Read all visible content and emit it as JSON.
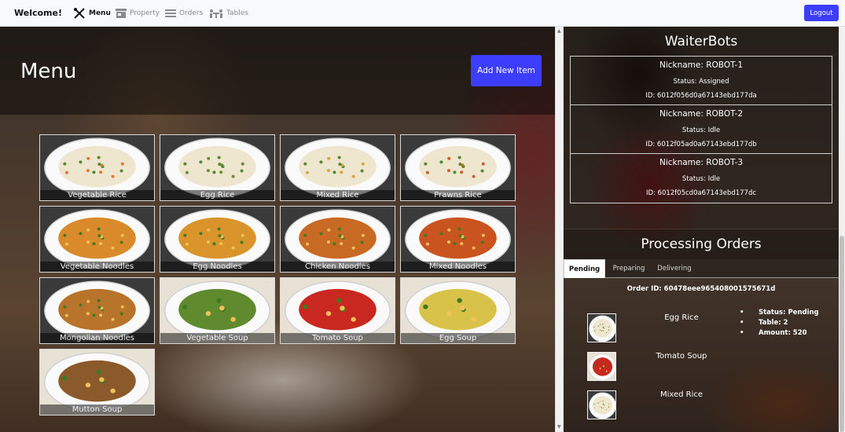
{
  "navbar": {
    "brand": "Welcome!",
    "links": [
      {
        "label": "Menu",
        "icon": "fork-knife-icon",
        "active": true
      },
      {
        "label": "Property",
        "icon": "store-icon",
        "active": false
      },
      {
        "label": "Orders",
        "icon": "list-icon",
        "active": false
      },
      {
        "label": "Tables",
        "icon": "table-icon",
        "active": false
      }
    ],
    "logout_label": "Logout"
  },
  "menu": {
    "title": "Menu",
    "add_button_label": "Add New Item",
    "items": [
      {
        "name": "Vegetable Rice",
        "kind": "rice",
        "accent": "#e07a2f"
      },
      {
        "name": "Egg Rice",
        "kind": "rice",
        "accent": "#6d8a3a"
      },
      {
        "name": "Mixed Rice",
        "kind": "rice",
        "accent": "#d9a441"
      },
      {
        "name": "Prawns Rice",
        "kind": "rice",
        "accent": "#c8622b"
      },
      {
        "name": "Vegetable Noodles",
        "kind": "noodles",
        "accent": "#d98a2b"
      },
      {
        "name": "Egg Noodles",
        "kind": "noodles",
        "accent": "#d9952b"
      },
      {
        "name": "Chicken Noodles",
        "kind": "noodles",
        "accent": "#c86a24"
      },
      {
        "name": "Mixed Noodles",
        "kind": "noodles",
        "accent": "#c9541f"
      },
      {
        "name": "Mongolian Noodles",
        "kind": "noodles",
        "accent": "#b8742b"
      },
      {
        "name": "Vegetable Soup",
        "kind": "soup",
        "accent": "#5f8a2e"
      },
      {
        "name": "Tomato Soup",
        "kind": "soup",
        "accent": "#c8281f"
      },
      {
        "name": "Egg Soup",
        "kind": "soup",
        "accent": "#d9c24a"
      },
      {
        "name": "Mutton Soup",
        "kind": "soup",
        "accent": "#8a5a2a"
      }
    ]
  },
  "waiterbots": {
    "title": "WaiterBots",
    "bots": [
      {
        "nickname": "Nickname: ROBOT-1",
        "status": "Status: Assigned",
        "id": "ID: 6012f056d0a67143ebd177da"
      },
      {
        "nickname": "Nickname: ROBOT-2",
        "status": "Status: Idle",
        "id": "ID: 6012f05ad0a67143ebd177db"
      },
      {
        "nickname": "Nickname: ROBOT-3",
        "status": "Status: Idle",
        "id": "ID: 6012f05cd0a67143ebd177dc"
      }
    ]
  },
  "orders": {
    "title": "Processing Orders",
    "tabs": [
      "Pending",
      "Preparing",
      "Delivering"
    ],
    "active_tab": "Pending",
    "order_id": "Order ID: 60478eee965408001575671d",
    "items": [
      {
        "name": "Egg Rice",
        "kind": "rice",
        "accent": "#6d8a3a"
      },
      {
        "name": "Tomato Soup",
        "kind": "soup",
        "accent": "#c8281f"
      },
      {
        "name": "Mixed Rice",
        "kind": "rice",
        "accent": "#d9a441"
      }
    ],
    "details": {
      "status": "Status: Pending",
      "table": "Table: 2",
      "amount": "Amount: 520"
    }
  },
  "colors": {
    "primary_button": "#3d3dff",
    "navbar_bg": "#f8f9fa"
  }
}
